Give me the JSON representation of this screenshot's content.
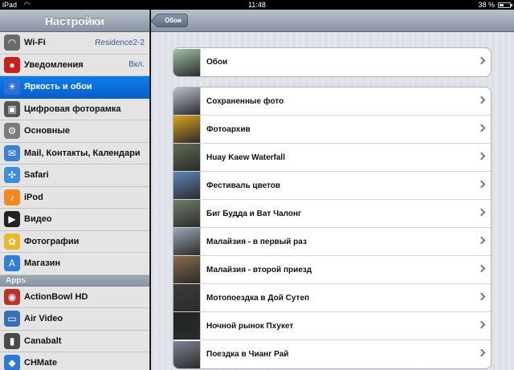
{
  "status_bar": {
    "carrier": "iPad",
    "time": "11:48",
    "battery": "38 %",
    "battery_level": 0.38
  },
  "sidebar": {
    "title": "Настройки",
    "items": [
      {
        "label": "Wi-Fi",
        "value": "Residence2-2",
        "icon": "wifi-icon",
        "color": "#6a6a6a"
      },
      {
        "label": "Уведомления",
        "value": "Вкл.",
        "icon": "notifications-icon",
        "color": "#c91f1f"
      },
      {
        "label": "Яркость и обои",
        "value": "",
        "icon": "brightness-icon",
        "color": "#2f6fd8",
        "selected": true
      },
      {
        "label": "Цифровая фоторамка",
        "value": "",
        "icon": "picture-frame-icon",
        "color": "#555555"
      },
      {
        "label": "Основные",
        "value": "",
        "icon": "gear-icon",
        "color": "#7b7b7b"
      },
      {
        "label": "Mail, Контакты, Календари",
        "value": "",
        "icon": "mail-icon",
        "color": "#3b7fd6"
      },
      {
        "label": "Safari",
        "value": "",
        "icon": "safari-icon",
        "color": "#3d8ce0"
      },
      {
        "label": "iPod",
        "value": "",
        "icon": "ipod-icon",
        "color": "#f08a1c"
      },
      {
        "label": "Видео",
        "value": "",
        "icon": "video-icon",
        "color": "#222222"
      },
      {
        "label": "Фотографии",
        "value": "",
        "icon": "photos-icon",
        "color": "#e8b82a"
      },
      {
        "label": "Магазин",
        "value": "",
        "icon": "store-icon",
        "color": "#2d7fd9"
      }
    ],
    "apps_header": "Apps",
    "apps": [
      {
        "label": "ActionBowl HD",
        "icon": "actionbowl-icon",
        "color": "#c0302a"
      },
      {
        "label": "Air Video",
        "icon": "air-video-icon",
        "color": "#3a6fb5"
      },
      {
        "label": "Canabalt",
        "icon": "canabalt-icon",
        "color": "#4a4a4a"
      },
      {
        "label": "CHMate",
        "icon": "chmate-icon",
        "color": "#2b7bd0"
      }
    ]
  },
  "detail": {
    "back_label": "Обои",
    "top_group": [
      {
        "label": "Обои",
        "thumb": "lotus-thumbnail",
        "color": "#9fc3a4"
      }
    ],
    "albums": [
      {
        "label": "Сохраненные фото",
        "thumb": "screenshot-thumbnail",
        "color": "#b9c2cf"
      },
      {
        "label": "Фотоархив",
        "thumb": "sunflower-thumbnail",
        "color": "#d9a21b"
      },
      {
        "label": "Huay Kaew Waterfall",
        "thumb": "waterfall-thumbnail",
        "color": "#5f6b53"
      },
      {
        "label": "Фестиваль цветов",
        "thumb": "flower-festival-thumbnail",
        "color": "#5d86b9"
      },
      {
        "label": "Биг Будда и Ват Чалонг",
        "thumb": "temple-thumbnail",
        "color": "#6f7f6a"
      },
      {
        "label": "Малайзия - в первый раз",
        "thumb": "malaysia-1-thumbnail",
        "color": "#9aa7b5"
      },
      {
        "label": "Малайзия - второй приезд",
        "thumb": "malaysia-2-thumbnail",
        "color": "#8a6a4a"
      },
      {
        "label": "Мотопоездка в Дой Сутеп",
        "thumb": "moto-trip-thumbnail",
        "color": "#3a3a3a"
      },
      {
        "label": "Ночной рынок Пхукет",
        "thumb": "night-market-thumbnail",
        "color": "#1f2224"
      },
      {
        "label": "Поездка в Чианг Рай",
        "thumb": "chiang-rai-thumbnail",
        "color": "#7c8493"
      }
    ]
  }
}
